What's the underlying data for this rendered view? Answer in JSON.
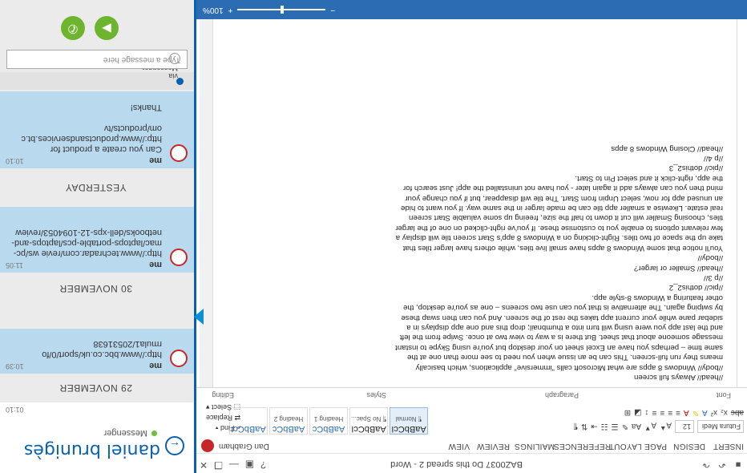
{
  "word": {
    "title": "BAZ0037 Do this spread 2 - Word",
    "tabs": [
      "INSERT",
      "DESIGN",
      "PAGE LAYOUT",
      "REFERENCES",
      "MAILINGS",
      "REVIEW",
      "VIEW"
    ],
    "user": "Dan Grabham",
    "font_name": "Futura Medi",
    "font_size": "12",
    "styles": [
      {
        "preview": "AaBbCcI",
        "name": "¶ Normal"
      },
      {
        "preview": "AaBbCcI",
        "name": "¶ No Spac..."
      },
      {
        "preview": "AaBbCc",
        "name": "Heading 1"
      },
      {
        "preview": "AaBbCc",
        "name": "Heading 2"
      },
      {
        "preview": "AaBbCcI",
        "name": ""
      }
    ],
    "groups": [
      "Font",
      "Paragraph",
      "Styles",
      "Editing"
    ],
    "editing": [
      "Find",
      "Replace",
      "Select"
    ],
    "document_text": "//head// Always full screen\n//body// Windows 8 apps are what Microsoft calls \"immersive\" applications, which basically means they run full-screen. This can be an issue when you need to see more than one at the same time – perhaps you have an Excel sheet on your desktop but you're using Skype to instant message someone about that sheet. But there is a way to view two at once. Swipe from the left and the last app you were using will turn into a thumbnail; drop this and one app displays in a sidebar pane while your current app takes the rest of the screen. And you can then swap these by swiping again. The alternative is that you can use two screens – one as you're desktop, the other featuring a Windows 8-style app.\n//pic// dothis2_2\n//p 3//\n//head// Smaller or larger?\n//body//\nYou'll notice that some Windows 8 apps have small live tiles, while others have larger tiles that take up the space of two tiles. Right-clicking on a Windows 8 app's Start screen tile will display a few relevant options to enable you to customise these. If you've right-clicked on one of the larger tiles, choosing Smaller will cut it down to half the size, freeing up some valuable Start screen real estate. Likewise a smaller app tile can be made larger in the same way. If you want to hide an unused app for now, select Unpin from Start. The tile will disappear, but if you change your mind then you can always add it again later - you have not uninstalled the app! Just search for the app, right-click it and select Pin to Start.\n//pic// dothis2_3\n//p 4//\n//head// Closing Windows 8 apps",
    "zoom": "100%"
  },
  "messenger": {
    "contact": "daniel brunigès",
    "service": "Messenger",
    "days": [
      "29 NOVEMBER",
      "30 NOVEMBER",
      "YESTERDAY"
    ],
    "messages": [
      {
        "sender": "me",
        "time": "10:39",
        "text": "http://www.bbc.co.uk/sport/0/fo rmula1/20531638"
      },
      {
        "sender": "me",
        "time": "11:05",
        "text": "http://www.techradar.com/revie ws/pc-mac/laptops-portable-pcs/laptops-and-netbooks/dell-xps-12-1094053/review"
      },
      {
        "sender": "me",
        "time": "10:10",
        "text": "Can you create a product for http://www.productsandservices.bt.c om/products/tv"
      },
      {
        "sender": "",
        "time": "",
        "text": "Thanks!"
      }
    ],
    "partial_time": "01:10",
    "via": "via Messenger",
    "input_placeholder": "Type a message here"
  }
}
